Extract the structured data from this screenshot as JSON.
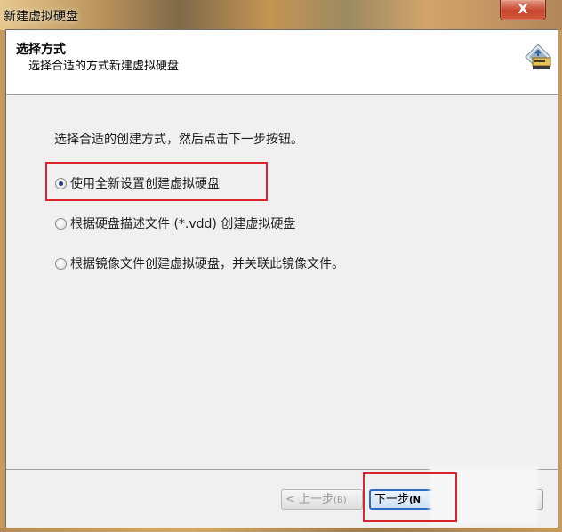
{
  "window": {
    "title": "新建虚拟硬盘",
    "close_label": "X"
  },
  "header": {
    "title": "选择方式",
    "subtitle": "选择合适的方式新建虚拟硬盘",
    "icon": "wizard-disk-icon"
  },
  "body": {
    "prompt": "选择合适的创建方式，然后点击下一步按钮。",
    "options": [
      {
        "label": "使用全新设置创建虚拟硬盘",
        "selected": true
      },
      {
        "label": "根据硬盘描述文件 (*.vdd) 创建虚拟硬盘",
        "selected": false
      },
      {
        "label": "根据镜像文件创建虚拟硬盘，并关联此镜像文件。",
        "selected": false
      }
    ]
  },
  "footer": {
    "back_label": "< 上一步",
    "back_accel": "(B)",
    "next_label": "下一步",
    "next_accel": "(N"
  },
  "colors": {
    "highlight": "#d9242b",
    "default_button_border": "#2c6ac4"
  }
}
